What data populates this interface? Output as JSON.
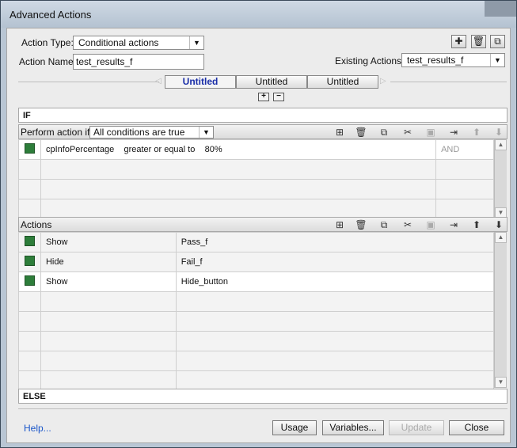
{
  "window": {
    "title": "Advanced Actions"
  },
  "form": {
    "action_type_label": "Action Type:",
    "action_type_value": "Conditional actions",
    "action_name_label": "Action Name:",
    "action_name_value": "test_results_f",
    "existing_label": "Existing Actions:",
    "existing_value": "test_results_f"
  },
  "tabs": [
    {
      "label": "Untitled",
      "active": true
    },
    {
      "label": "Untitled",
      "active": false
    },
    {
      "label": "Untitled",
      "active": false
    }
  ],
  "if_section": {
    "header": "IF",
    "perform_label": "Perform action if:",
    "perform_value": "All conditions are true",
    "conditions": [
      {
        "var": "cpInfoPercentage",
        "op": "greater or equal to",
        "value": "80%",
        "logic": "AND"
      }
    ]
  },
  "actions_section": {
    "header": "Actions",
    "rows": [
      {
        "action": "Show",
        "target": "Pass_f"
      },
      {
        "action": "Hide",
        "target": "Fail_f"
      },
      {
        "action": "Show",
        "target": "Hide_button"
      }
    ]
  },
  "else_label": "ELSE",
  "footer": {
    "help": "Help...",
    "usage": "Usage",
    "variables": "Variables...",
    "update": "Update",
    "close": "Close"
  },
  "colors": {
    "row_square": "#2d7d3a",
    "active_tab_text": "#1a2ea8"
  },
  "icons": [
    "plus-icon",
    "trash-icon",
    "duplicate-icon",
    "scissors-icon",
    "paste-icon",
    "insert-icon",
    "arrow-up-icon",
    "arrow-down-icon"
  ]
}
